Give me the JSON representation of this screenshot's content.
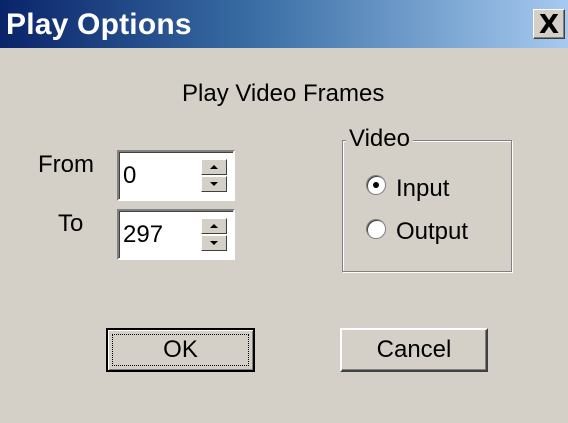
{
  "dialog": {
    "title": "Play Options",
    "close_glyph": "X",
    "heading": "Play Video Frames"
  },
  "range": {
    "from_label": "From",
    "from_value": "0",
    "to_label": "To",
    "to_value": "297"
  },
  "video_group": {
    "label": "Video",
    "options": [
      {
        "label": "Input",
        "selected": true
      },
      {
        "label": "Output",
        "selected": false
      }
    ]
  },
  "buttons": {
    "ok": "OK",
    "cancel": "Cancel"
  },
  "icons": [
    "close-icon",
    "spin-up-icon",
    "spin-down-icon",
    "radio-selected-icon",
    "radio-empty-icon"
  ],
  "colors": {
    "titlebar_start": "#0a246a",
    "titlebar_end": "#a6caf0",
    "face": "#d4d0c8"
  }
}
